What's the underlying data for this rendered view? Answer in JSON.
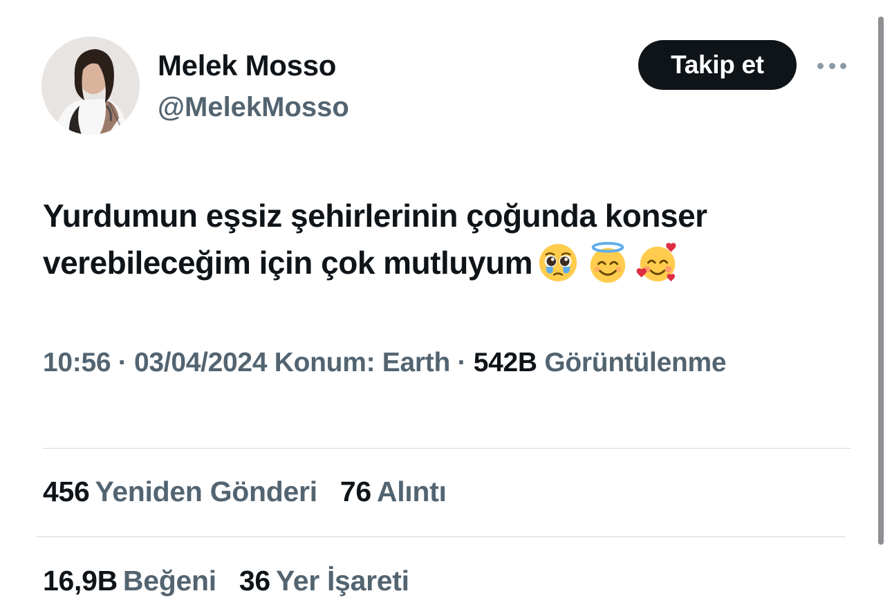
{
  "author": {
    "display_name": "Melek Mosso",
    "handle": "@MelekMosso",
    "follow_label": "Takip et"
  },
  "tweet": {
    "text": "Yurdumun eşsiz şehirlerinin çoğunda konser verebileceğim için çok mutluyum",
    "emojis": [
      "pleading-face-with-tears-icon",
      "smiling-face-with-halo-icon",
      "smiling-face-with-hearts-icon"
    ]
  },
  "meta": {
    "time": "10:56",
    "date": "03/04/2024",
    "location": "Konum: Earth",
    "views_count": "542B",
    "views_label": "Görüntülenme"
  },
  "stats": {
    "reposts_count": "456",
    "reposts_label": "Yeniden Gönderi",
    "quotes_count": "76",
    "quotes_label": "Alıntı",
    "likes_count": "16,9B",
    "likes_label": "Beğeni",
    "bookmarks_count": "36",
    "bookmarks_label": "Yer İşareti"
  },
  "colors": {
    "text_primary": "#0f1419",
    "text_secondary": "#536471",
    "button_bg": "#0f1419",
    "divider": "#cfd9de"
  }
}
